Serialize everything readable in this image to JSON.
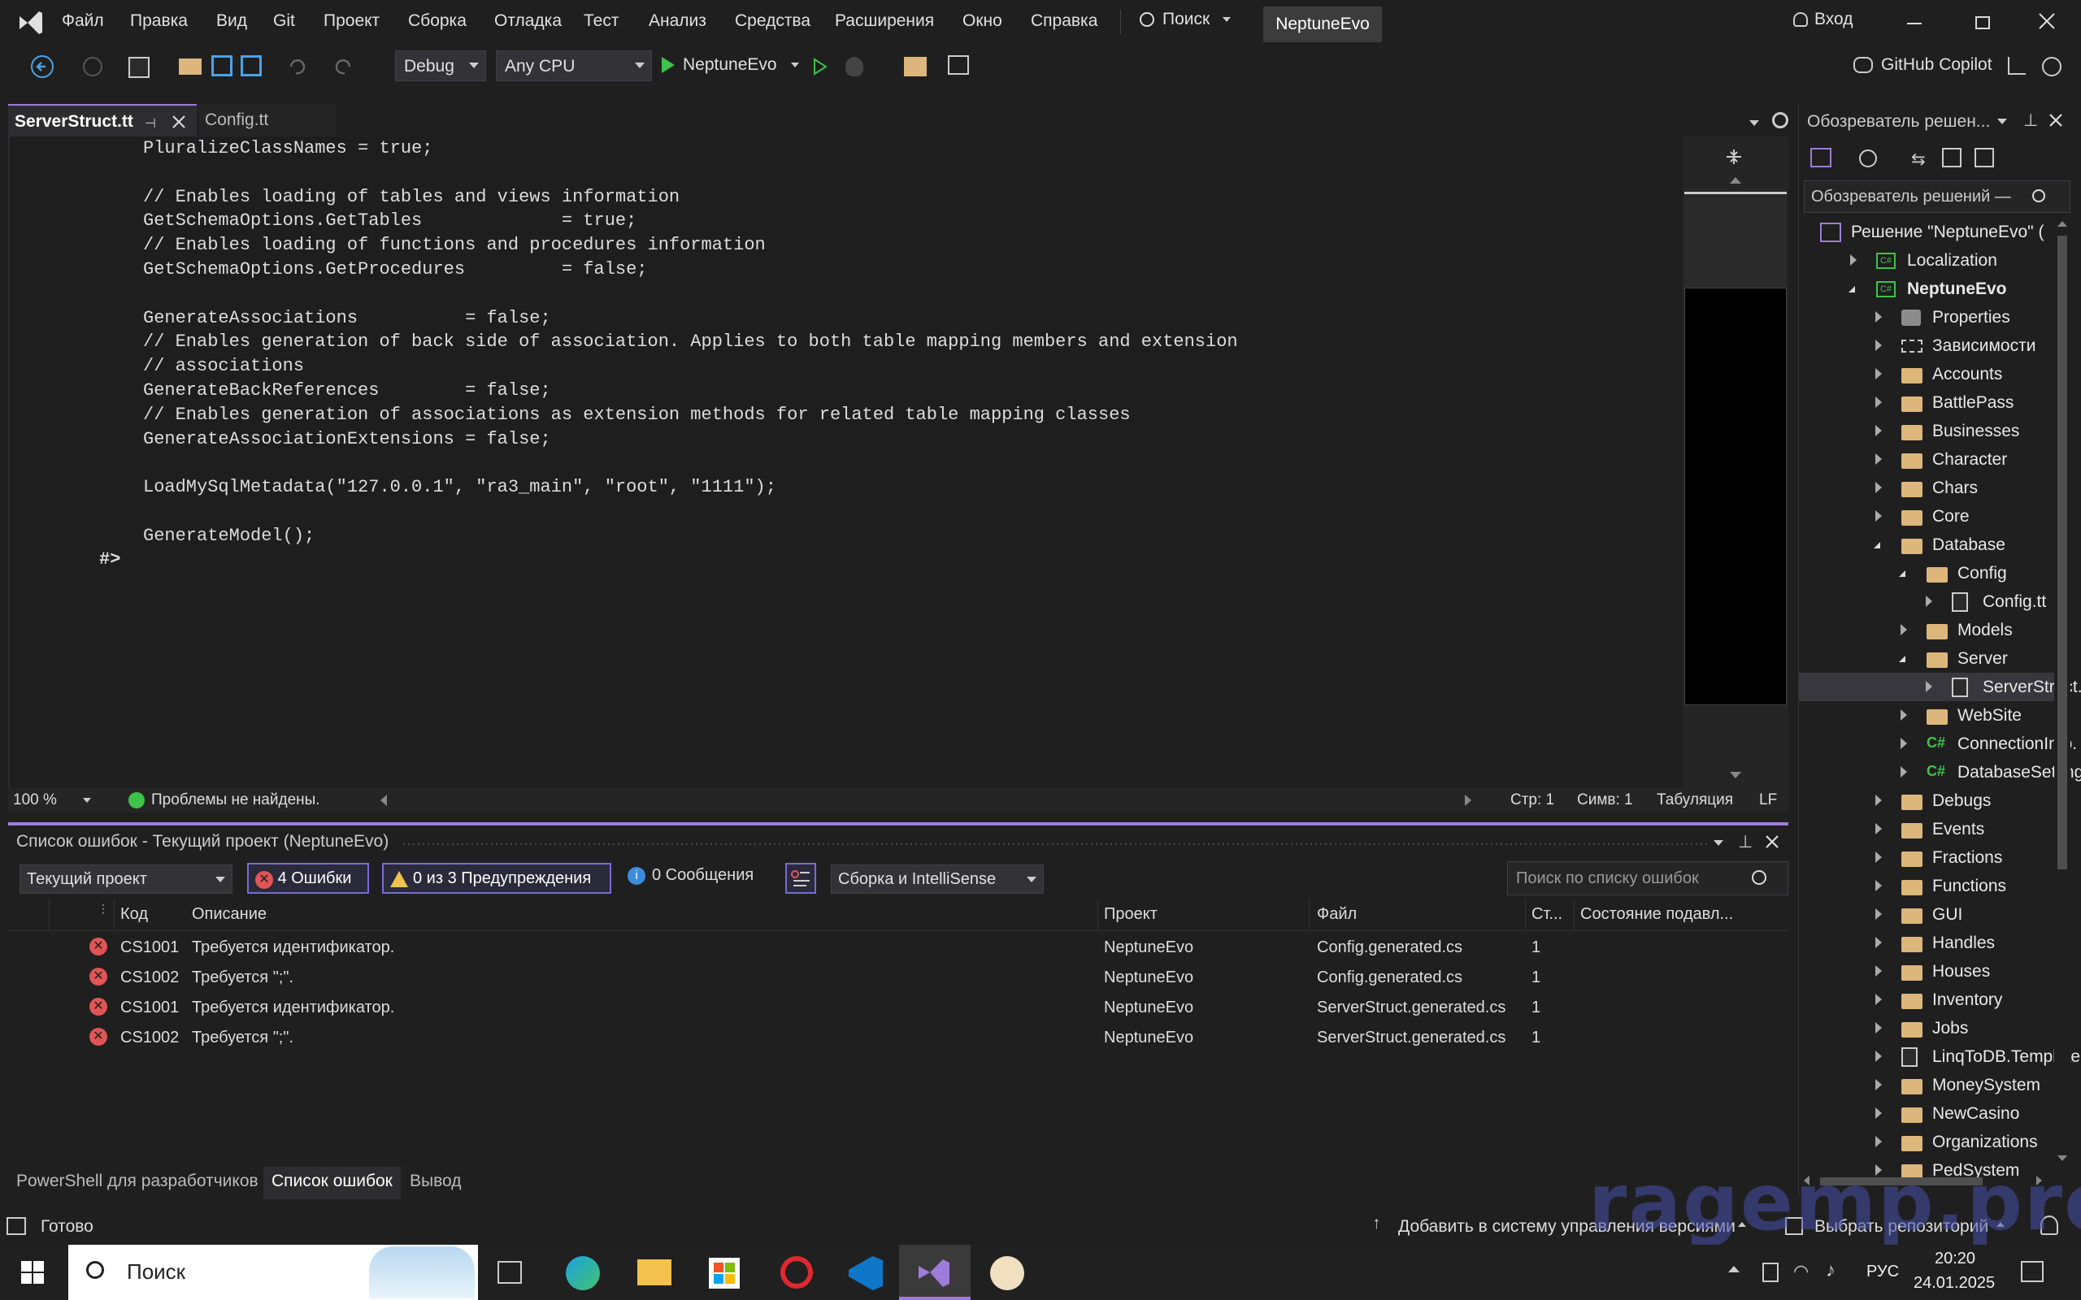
{
  "titlebar": {
    "menus": [
      "Файл",
      "Правка",
      "Вид",
      "Git",
      "Проект",
      "Сборка",
      "Отладка",
      "Тест",
      "Анализ",
      "Средства",
      "Расширения",
      "Окно",
      "Справка"
    ],
    "search": "Поиск",
    "solution_badge": "NeptuneEvo",
    "signin": "Вход"
  },
  "toolbar": {
    "config": "Debug",
    "platform": "Any CPU",
    "run_target": "NeptuneEvo",
    "copilot": "GitHub Copilot"
  },
  "editor": {
    "tabs": [
      "ServerStruct.tt",
      "Config.tt"
    ],
    "code_lines": [
      "PluralizeClassNames = true;",
      "",
      "// Enables loading of tables and views information",
      "GetSchemaOptions.GetTables             = true;",
      "// Enables loading of functions and procedures information",
      "GetSchemaOptions.GetProcedures         = false;",
      "",
      "GenerateAssociations          = false;",
      "// Enables generation of back side of association. Applies to both table mapping members and extension",
      "// associations",
      "GenerateBackReferences        = false;",
      "// Enables generation of associations as extension methods for related table mapping classes",
      "GenerateAssociationExtensions = false;",
      "",
      "LoadMySqlMetadata(\"127.0.0.1\", \"ra3_main\", \"root\", \"1111\");",
      "",
      "GenerateModel();"
    ],
    "closing_tag": "#>",
    "status": {
      "zoom": "100 %",
      "problems": "Проблемы не найдены.",
      "line": "Стр: 1",
      "col": "Симв: 1",
      "indent": "Табуляция",
      "eol": "LF"
    }
  },
  "errorlist": {
    "title": "Список ошибок - Текущий проект (NeptuneEvo)",
    "scope": "Текущий проект",
    "errors_btn": "4 Ошибки",
    "warnings_btn": "0 из 3 Предупреждения",
    "messages_btn": "0 Сообщения",
    "source": "Сборка и IntelliSense",
    "search_placeholder": "Поиск по списку ошибок",
    "columns": [
      "Код",
      "Описание",
      "Проект",
      "Файл",
      "Ст...",
      "Состояние подавл..."
    ],
    "rows": [
      {
        "code": "CS1001",
        "desc": "Требуется идентификатор.",
        "project": "NeptuneEvo",
        "file": "Config.generated.cs",
        "line": "1"
      },
      {
        "code": "CS1002",
        "desc": "Требуется \";\".",
        "project": "NeptuneEvo",
        "file": "Config.generated.cs",
        "line": "1"
      },
      {
        "code": "CS1001",
        "desc": "Требуется идентификатор.",
        "project": "NeptuneEvo",
        "file": "ServerStruct.generated.cs",
        "line": "1"
      },
      {
        "code": "CS1002",
        "desc": "Требуется \";\".",
        "project": "NeptuneEvo",
        "file": "ServerStruct.generated.cs",
        "line": "1"
      }
    ],
    "bottom_tabs": [
      "PowerShell для разработчиков",
      "Список ошибок",
      "Вывод"
    ]
  },
  "solution_explorer": {
    "title": "Обозреватель решен...",
    "search": "Обозреватель решений —",
    "items": [
      {
        "label": "Решение \"NeptuneEvo\" (",
        "kind": "solution"
      },
      {
        "label": "Localization",
        "kind": "csproj"
      },
      {
        "label": "NeptuneEvo",
        "kind": "csproj-bold"
      },
      {
        "label": "Properties",
        "kind": "props"
      },
      {
        "label": "Зависимости",
        "kind": "deps"
      },
      {
        "label": "Accounts",
        "kind": "folder"
      },
      {
        "label": "BattlePass",
        "kind": "folder"
      },
      {
        "label": "Businesses",
        "kind": "folder"
      },
      {
        "label": "Character",
        "kind": "folder"
      },
      {
        "label": "Chars",
        "kind": "folder"
      },
      {
        "label": "Core",
        "kind": "folder"
      },
      {
        "label": "Database",
        "kind": "folder"
      },
      {
        "label": "Config",
        "kind": "folder"
      },
      {
        "label": "Config.tt",
        "kind": "file"
      },
      {
        "label": "Models",
        "kind": "folder"
      },
      {
        "label": "Server",
        "kind": "folder"
      },
      {
        "label": "ServerStruct.",
        "kind": "file"
      },
      {
        "label": "WebSite",
        "kind": "folder"
      },
      {
        "label": "ConnectionInfo.",
        "kind": "cs"
      },
      {
        "label": "DatabaseSetting",
        "kind": "cs"
      },
      {
        "label": "Debugs",
        "kind": "folder"
      },
      {
        "label": "Events",
        "kind": "folder"
      },
      {
        "label": "Fractions",
        "kind": "folder"
      },
      {
        "label": "Functions",
        "kind": "folder"
      },
      {
        "label": "GUI",
        "kind": "folder"
      },
      {
        "label": "Handles",
        "kind": "folder"
      },
      {
        "label": "Houses",
        "kind": "folder"
      },
      {
        "label": "Inventory",
        "kind": "folder"
      },
      {
        "label": "Jobs",
        "kind": "folder"
      },
      {
        "label": "LinqToDB.Template",
        "kind": "file"
      },
      {
        "label": "MoneySystem",
        "kind": "folder"
      },
      {
        "label": "NewCasino",
        "kind": "folder"
      },
      {
        "label": "Organizations",
        "kind": "folder"
      },
      {
        "label": "PedSystem",
        "kind": "folder"
      }
    ]
  },
  "statusbar": {
    "ready": "Готово",
    "vcs": "Добавить в систему управления версиями",
    "repo": "Выбрать репозиторий"
  },
  "watermark": "ragemp.pro",
  "taskbar": {
    "search": "Поиск",
    "lang": "РУС",
    "time": "20:20",
    "date": "24.01.2025"
  }
}
